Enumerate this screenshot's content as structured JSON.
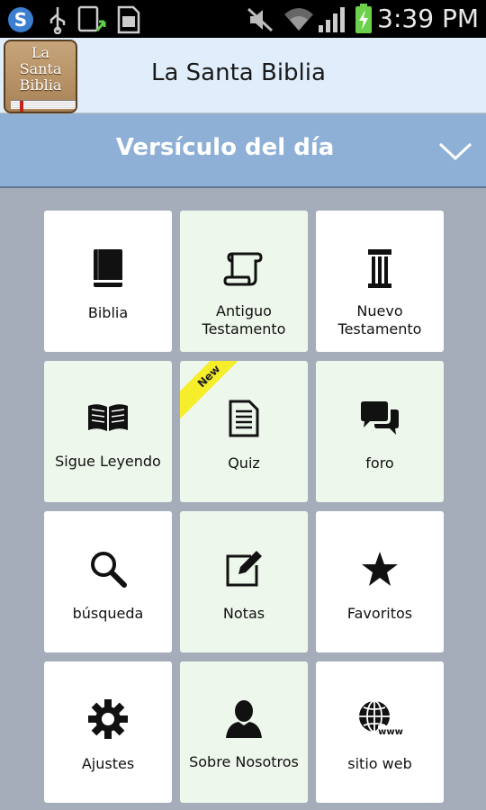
{
  "status_bar": {
    "time": "3:39 PM",
    "icons": [
      "app-s-icon",
      "usb-icon",
      "phone-upload-icon",
      "sd-card-icon",
      "mute-icon",
      "wifi-icon",
      "signal-icon",
      "battery-charging-icon"
    ]
  },
  "app_bar": {
    "logo_text": "La Santa Biblia",
    "title": "La Santa Biblia"
  },
  "verse_bar": {
    "title": "Versículo del día",
    "chevron_icon": "chevron-down-icon"
  },
  "tiles": [
    {
      "label": "Biblia",
      "icon": "book-icon"
    },
    {
      "label": "Antiguo Testamento",
      "icon": "scroll-icon"
    },
    {
      "label": "Nuevo Testamento",
      "icon": "pillar-icon"
    },
    {
      "label": "Sigue Leyendo",
      "icon": "open-book-icon"
    },
    {
      "label": "Quiz",
      "icon": "document-icon",
      "badge": "New"
    },
    {
      "label": "foro",
      "icon": "chat-bubbles-icon"
    },
    {
      "label": "búsqueda",
      "icon": "search-icon"
    },
    {
      "label": "Notas",
      "icon": "edit-note-icon"
    },
    {
      "label": "Favoritos",
      "icon": "star-icon"
    },
    {
      "label": "Ajustes",
      "icon": "gear-icon"
    },
    {
      "label": "Sobre Nosotros",
      "icon": "person-icon"
    },
    {
      "label": "sitio web",
      "icon": "globe-www-icon"
    }
  ],
  "colors": {
    "status_bar": "#000000",
    "app_bar": "#e0eefb",
    "verse_bar": "#8fb0d6",
    "background": "#a4adb9",
    "tile_white": "#ffffff",
    "tile_green": "#eef7ec",
    "new_badge": "#f7ee2b"
  }
}
